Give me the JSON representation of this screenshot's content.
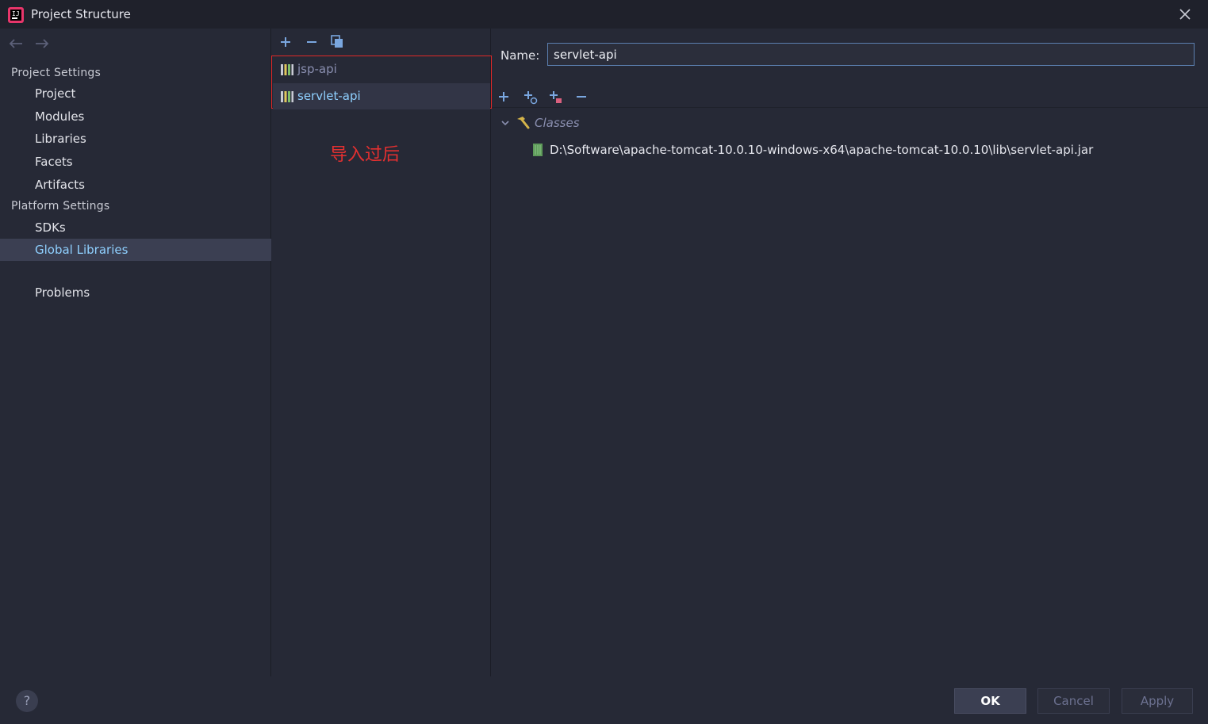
{
  "window": {
    "title": "Project Structure"
  },
  "left_nav": {
    "project_settings_header": "Project Settings",
    "project_items": [
      "Project",
      "Modules",
      "Libraries",
      "Facets",
      "Artifacts"
    ],
    "platform_settings_header": "Platform Settings",
    "platform_items": [
      "SDKs",
      "Global Libraries"
    ],
    "selected": "Global Libraries",
    "problems": "Problems"
  },
  "libraries": {
    "items": [
      "jsp-api",
      "servlet-api"
    ],
    "selected": "servlet-api",
    "annotation": "导入过后"
  },
  "detail": {
    "name_label": "Name:",
    "name_value": "servlet-api",
    "classes_label": "Classes",
    "jar_path": "D:\\Software\\apache-tomcat-10.0.10-windows-x64\\apache-tomcat-10.0.10\\lib\\servlet-api.jar"
  },
  "footer": {
    "help": "?",
    "ok": "OK",
    "cancel": "Cancel",
    "apply": "Apply"
  },
  "colors": {
    "background": "#262936",
    "selection": "#3b3f52",
    "selected_text": "#8fd0ff",
    "annotation": "#e53030"
  }
}
